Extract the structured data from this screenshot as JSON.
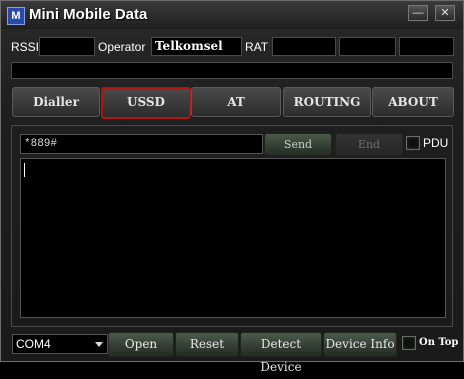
{
  "window": {
    "title": "Mini Mobile Data",
    "icon_letter": "M",
    "minimize": "—",
    "close": "✕"
  },
  "info": {
    "rssi_label": "RSSI",
    "rssi_value": "",
    "operator_label": "Operator",
    "operator_value": "Telkomsel",
    "rat_label": "RAT",
    "rat_value": ""
  },
  "tabs": [
    {
      "label": "Dialler"
    },
    {
      "label": "USSD"
    },
    {
      "label": "AT"
    },
    {
      "label": "ROUTING"
    },
    {
      "label": "ABOUT"
    }
  ],
  "ussd": {
    "input_value": "*889#",
    "send_label": "Send",
    "end_label": "End",
    "pdu_label": "PDU",
    "output": ""
  },
  "bottom": {
    "port_value": "COM4",
    "open_label": "Open",
    "reset_label": "Reset",
    "detect_label": "Detect Device",
    "info_label": "Device Info",
    "ontop_label": "On Top"
  },
  "colors": {
    "active_tab_border": "#b11414",
    "accent_green": "#4a5a4a"
  }
}
